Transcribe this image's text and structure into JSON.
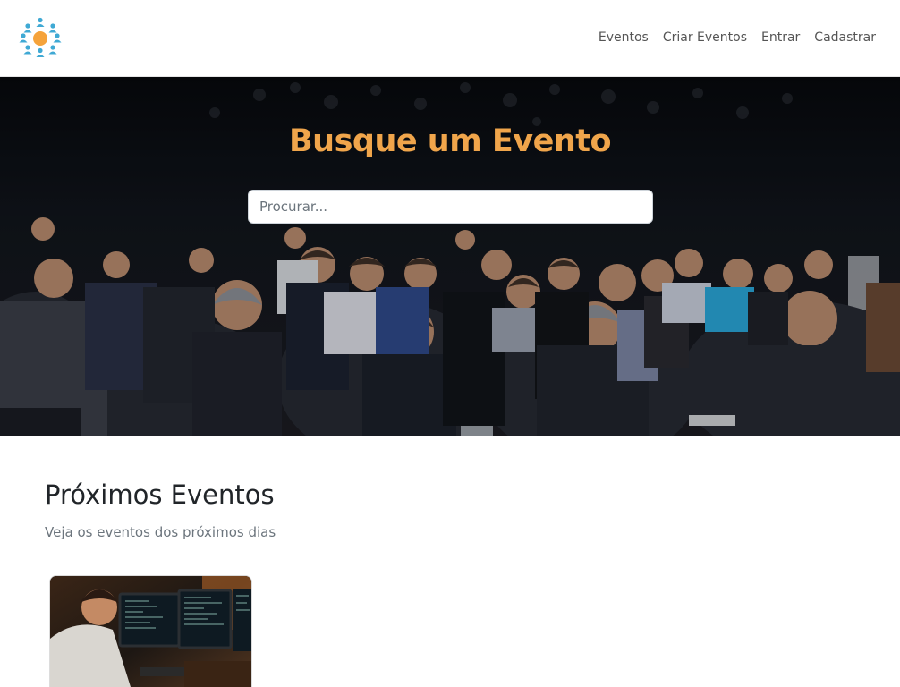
{
  "nav": {
    "links": [
      "Eventos",
      "Criar Eventos",
      "Entrar",
      "Cadastrar"
    ]
  },
  "hero": {
    "title": "Busque um Evento",
    "search_placeholder": "Procurar..."
  },
  "events_section": {
    "title": "Próximos Eventos",
    "subtitle": "Veja os eventos dos próximos dias"
  },
  "colors": {
    "accent": "#f0a54b",
    "logo_center": "#f5a33b",
    "logo_people": "#3fa9d4"
  }
}
